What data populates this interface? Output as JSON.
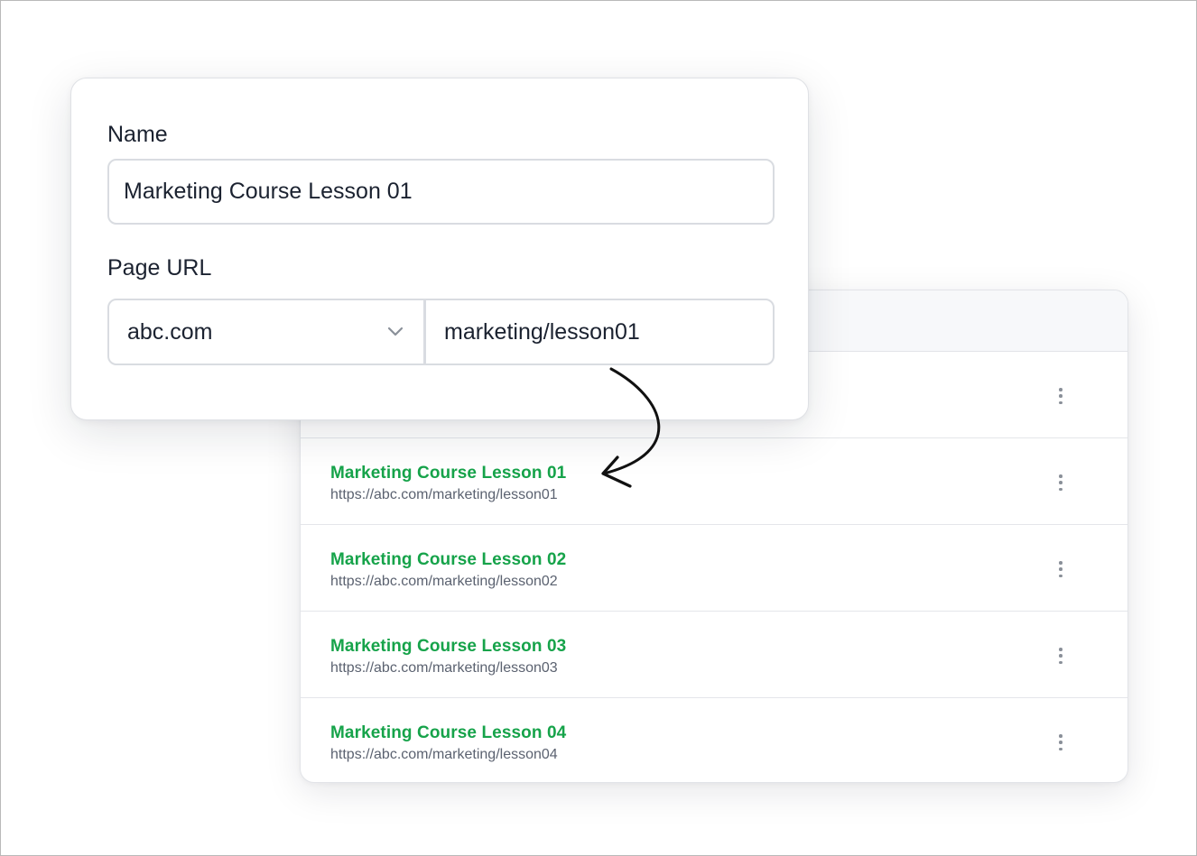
{
  "form": {
    "name_label": "Name",
    "name_value": "Marketing Course Lesson 01",
    "url_label": "Page URL",
    "domain_value": "abc.com",
    "path_value": "marketing/lesson01"
  },
  "pages": [
    {
      "title": "Marketing Course Lesson 01",
      "url": "https://abc.com/marketing/lesson01"
    },
    {
      "title": "Marketing Course Lesson 02",
      "url": "https://abc.com/marketing/lesson02"
    },
    {
      "title": "Marketing Course Lesson 03",
      "url": "https://abc.com/marketing/lesson03"
    },
    {
      "title": "Marketing Course Lesson 04",
      "url": "https://abc.com/marketing/lesson04"
    }
  ],
  "colors": {
    "title_green": "#16a34a",
    "url_gray": "#5b6270",
    "border": "#d9dce1"
  },
  "icons": {
    "row_menu": "kebab-menu-icon",
    "select_chevron": "chevron-down-icon",
    "annotation": "curved-arrow-icon"
  }
}
